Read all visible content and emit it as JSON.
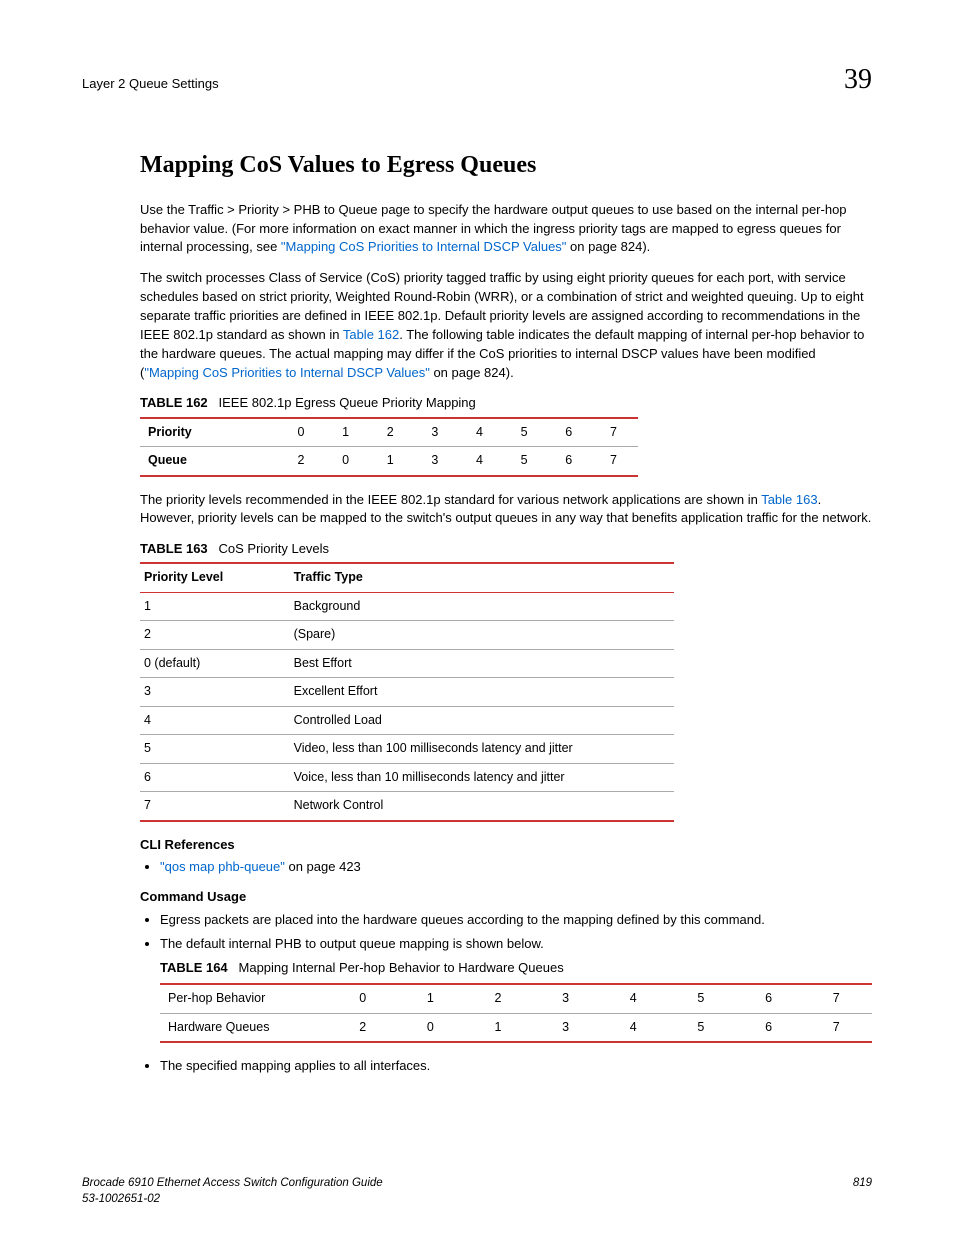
{
  "header": {
    "left": "Layer 2 Queue Settings",
    "right": "39"
  },
  "title": "Mapping CoS Values to Egress Queues",
  "para1_a": "Use the Traffic > Priority > PHB to Queue page to specify the hardware output queues to use based on the internal per-hop behavior value. (For more information on exact manner in which the ingress priority tags are mapped to egress queues for internal processing, see ",
  "para1_link": "\"Mapping CoS Priorities to Internal DSCP Values\"",
  "para1_b": " on page 824).",
  "para2_a": "The switch processes Class of Service (CoS) priority tagged traffic by using eight priority queues for each port, with service schedules based on strict priority, Weighted Round-Robin (WRR), or a combination of strict and weighted queuing. Up to eight separate traffic priorities are defined in IEEE 802.1p. Default priority levels are assigned according to recommendations in the IEEE 802.1p standard as shown in ",
  "para2_link1": "Table 162",
  "para2_b": ". The following table indicates the default mapping of internal per-hop behavior to the hardware queues. The actual mapping may differ if the CoS priorities to internal DSCP values have been modified (",
  "para2_link2": "\"Mapping CoS Priorities to Internal DSCP Values\"",
  "para2_c": " on page 824).",
  "table162": {
    "caption_label": "TABLE 162",
    "caption_text": "IEEE 802.1p Egress Queue Priority Mapping",
    "row1_label": "Priority",
    "row1": [
      "0",
      "1",
      "2",
      "3",
      "4",
      "5",
      "6",
      "7"
    ],
    "row2_label": "Queue",
    "row2": [
      "2",
      "0",
      "1",
      "3",
      "4",
      "5",
      "6",
      "7"
    ]
  },
  "para3_a": "The priority levels recommended in the IEEE 802.1p standard for various network applications are shown in ",
  "para3_link": "Table 163",
  "para3_b": ". However, priority levels can be mapped to the switch's output queues in any way that benefits application traffic for the network.",
  "table163": {
    "caption_label": "TABLE 163",
    "caption_text": "CoS Priority Levels",
    "head1": "Priority Level",
    "head2": "Traffic Type",
    "rows": [
      {
        "level": "1",
        "type": "Background"
      },
      {
        "level": "2",
        "type": "(Spare)"
      },
      {
        "level": "0 (default)",
        "type": "Best Effort"
      },
      {
        "level": "3",
        "type": "Excellent Effort"
      },
      {
        "level": "4",
        "type": "Controlled Load"
      },
      {
        "level": "5",
        "type": "Video, less than 100 milliseconds latency and jitter"
      },
      {
        "level": "6",
        "type": "Voice, less than 10 milliseconds latency and jitter"
      },
      {
        "level": "7",
        "type": "Network Control"
      }
    ]
  },
  "cli_ref_head": "CLI References",
  "cli_ref_link": "\"qos map phb-queue\"",
  "cli_ref_suffix": " on page 423",
  "cmd_usage_head": "Command Usage",
  "cmd_usage_items": {
    "item1": "Egress packets are placed into the hardware queues according to the mapping defined by this command.",
    "item2": "The default internal PHB to output queue mapping is shown below.",
    "item3": "The specified mapping applies to all interfaces."
  },
  "table164": {
    "caption_label": "TABLE 164",
    "caption_text": "Mapping Internal Per-hop Behavior to Hardware Queues",
    "row1_label": "Per-hop Behavior",
    "row1": [
      "0",
      "1",
      "2",
      "3",
      "4",
      "5",
      "6",
      "7"
    ],
    "row2_label": "Hardware Queues",
    "row2": [
      "2",
      "0",
      "1",
      "3",
      "4",
      "5",
      "6",
      "7"
    ]
  },
  "footer": {
    "left1": "Brocade 6910 Ethernet Access Switch Configuration Guide",
    "left2": "53-1002651-02",
    "right": "819"
  }
}
